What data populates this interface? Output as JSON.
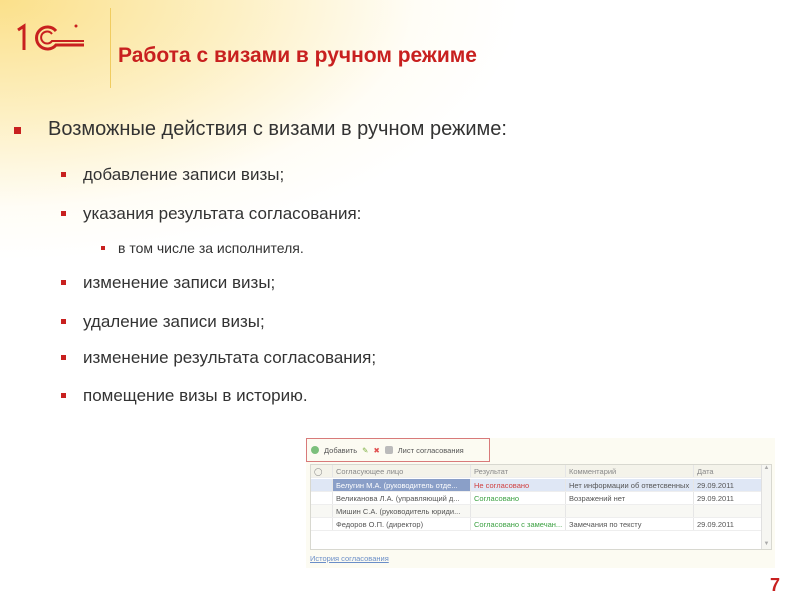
{
  "logo": "1С",
  "title": "Работа с визами в ручном режиме",
  "main_bullet": "Возможные действия с визами в ручном режиме:",
  "items": [
    "добавление записи визы;",
    "указания результата согласования:",
    "изменение записи визы;",
    "удаление записи визы;",
    "изменение результата согласования;",
    "помещение визы в историю."
  ],
  "subitem": "в том числе за исполнителя.",
  "page_number": "7",
  "screenshot": {
    "toolbar": {
      "add": "Добавить",
      "sheet": "Лист согласования"
    },
    "headers": [
      "Согласующее лицо",
      "Результат",
      "Комментарий",
      "Дата"
    ],
    "rows": [
      {
        "name": "Белугин М.А. (руководитель отде...",
        "result": "Не согласовано",
        "comment": "Нет информации об ответсвенных",
        "date": "29.09.2011"
      },
      {
        "name": "Великанова Л.А. (управляющий д...",
        "result": "Согласовано",
        "comment": "Возражений нет",
        "date": "29.09.2011"
      },
      {
        "name": "Мишин С.А. (руководитель юриди...",
        "result": "",
        "comment": "",
        "date": ""
      },
      {
        "name": "Федоров О.П. (директор)",
        "result": "Согласовано с замечан...",
        "comment": "Замечания по тексту",
        "date": "29.09.2011"
      }
    ],
    "history_link": "История согласования"
  },
  "colors": {
    "accent": "#c8201f",
    "rejected": "#d04040",
    "approved": "#3aa040"
  }
}
